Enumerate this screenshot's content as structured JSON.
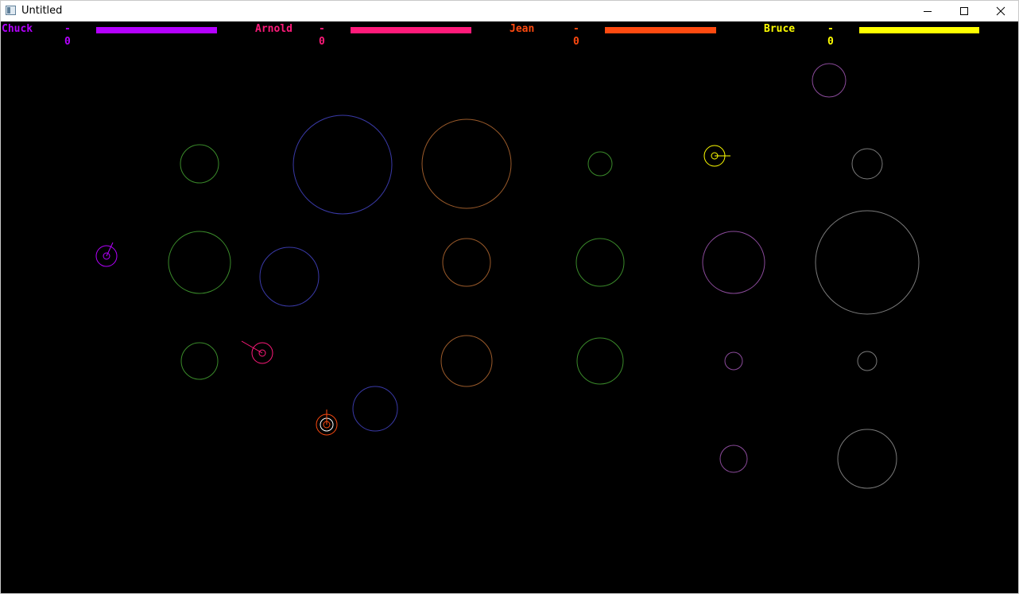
{
  "window": {
    "title": "Untitled"
  },
  "players": [
    {
      "name": "Chuck",
      "score": "- 0",
      "color": "#b400ff",
      "health": 1.0
    },
    {
      "name": "Arnold",
      "score": "- 0",
      "color": "#ff1a7a",
      "health": 1.0
    },
    {
      "name": "Jean",
      "score": "- 0",
      "color": "#ff4a10",
      "health": 1.0
    },
    {
      "name": "Bruce",
      "score": "- 0",
      "color": "#ffff00",
      "health": 1.0
    }
  ],
  "obstacle_colors": {
    "green": "#3a8a2a",
    "blue": "#3a3aa8",
    "orange": "#9a5a2a",
    "purple": "#8a4a9a",
    "gray": "#7a7a7a"
  }
}
